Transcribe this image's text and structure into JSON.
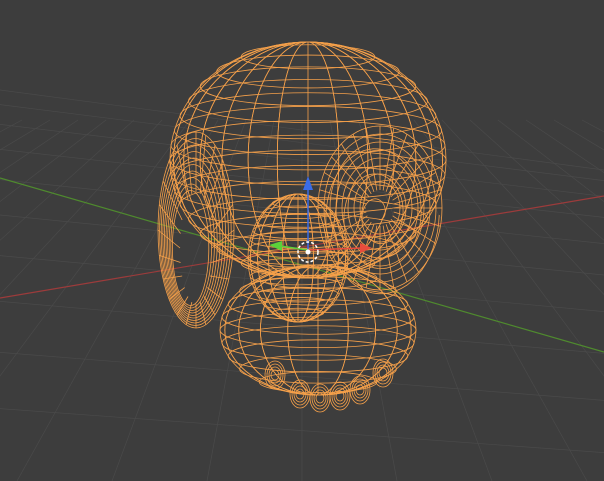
{
  "viewport": {
    "background": "#3d3d3d",
    "view": "perspective",
    "shading": "wireframe"
  },
  "grid": {
    "floor_color": "#4a4a4a",
    "x_axis_color": "#9c3b3b",
    "y_axis_color": "#4f8a2e"
  },
  "object": {
    "kind": "skull-mesh",
    "selected": true,
    "wire_color": "#f5a04a"
  },
  "gizmo": {
    "x_color": "#e84c3d",
    "y_color": "#5bd13a",
    "z_color": "#3a6ce8",
    "pivot_color": "#ffffff"
  }
}
